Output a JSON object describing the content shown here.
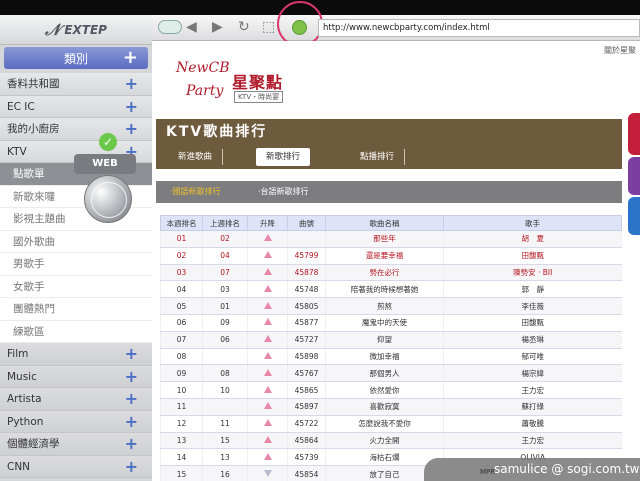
{
  "sidebar": {
    "logo": "EXTEP",
    "category": "類別",
    "items": [
      {
        "label": "香料共和國",
        "kind": "group"
      },
      {
        "label": "EC IC",
        "kind": "group"
      },
      {
        "label": "我的小廚房",
        "kind": "group"
      },
      {
        "label": "KTV",
        "kind": "group"
      },
      {
        "label": "點歌單",
        "kind": "sub-active"
      },
      {
        "label": "新歌來囉",
        "kind": "sub"
      },
      {
        "label": "影視主題曲",
        "kind": "sub"
      },
      {
        "label": "國外歌曲",
        "kind": "sub"
      },
      {
        "label": "男歌手",
        "kind": "sub"
      },
      {
        "label": "女歌手",
        "kind": "sub"
      },
      {
        "label": "團體熱門",
        "kind": "sub"
      },
      {
        "label": "練歌區",
        "kind": "sub"
      },
      {
        "label": "Film",
        "kind": "dark"
      },
      {
        "label": "Music",
        "kind": "dark"
      },
      {
        "label": "Artista",
        "kind": "dark"
      },
      {
        "label": "Python",
        "kind": "dark"
      },
      {
        "label": "個體經濟學",
        "kind": "dark"
      },
      {
        "label": "CNN",
        "kind": "dark"
      }
    ],
    "web_badge": "WEB"
  },
  "toolbar": {
    "url": "http://www.newcbparty.com/index.html"
  },
  "page": {
    "about": "關於星聚",
    "logo_newcb": "NewCB",
    "logo_party": "Party",
    "logo_cn": "星聚點",
    "logo_sub": "KTV・時尚宴",
    "title": "KTV歌曲排行",
    "tabs": [
      "新進歌曲",
      "新歌排行",
      "點播排行"
    ],
    "sub_tabs": [
      "‧國語新歌排行",
      "‧台語新歌排行"
    ],
    "table_headers": [
      "本週排名",
      "上週排名",
      "升降",
      "曲號",
      "歌曲名稱",
      "歌手"
    ],
    "rows": [
      {
        "rank": "01",
        "last": "02",
        "trend": "up",
        "code": "",
        "song": "那些年",
        "singer": "胡　夏",
        "red": true
      },
      {
        "rank": "02",
        "last": "04",
        "trend": "up",
        "code": "45799",
        "song": "還是要幸福",
        "singer": "田馥甄",
        "red": true
      },
      {
        "rank": "03",
        "last": "07",
        "trend": "up",
        "code": "45878",
        "song": "勢在必行",
        "singer": "陳勢安 · BII",
        "red": true
      },
      {
        "rank": "04",
        "last": "03",
        "trend": "up",
        "code": "45748",
        "song": "陪著我的時候想著她",
        "singer": "郭　靜",
        "red": false
      },
      {
        "rank": "05",
        "last": "01",
        "trend": "up",
        "code": "45805",
        "song": "煎熬",
        "singer": "李佳薇",
        "red": false
      },
      {
        "rank": "06",
        "last": "09",
        "trend": "up",
        "code": "45877",
        "song": "魔鬼中的天使",
        "singer": "田馥甄",
        "red": false
      },
      {
        "rank": "07",
        "last": "06",
        "trend": "up",
        "code": "45727",
        "song": "仰望",
        "singer": "楊丞琳",
        "red": false
      },
      {
        "rank": "08",
        "last": "",
        "trend": "up",
        "code": "45898",
        "song": "微加幸福",
        "singer": "郁可唯",
        "red": false
      },
      {
        "rank": "09",
        "last": "08",
        "trend": "up",
        "code": "45767",
        "song": "那個男人",
        "singer": "楊宗緯",
        "red": false
      },
      {
        "rank": "10",
        "last": "10",
        "trend": "up",
        "code": "45865",
        "song": "依然愛你",
        "singer": "王力宏",
        "red": false
      },
      {
        "rank": "11",
        "last": "",
        "trend": "up",
        "code": "45897",
        "song": "喜歡寂寞",
        "singer": "蘇打綠",
        "red": false
      },
      {
        "rank": "12",
        "last": "11",
        "trend": "up",
        "code": "45722",
        "song": "怎麼說我不愛你",
        "singer": "蕭敬騰",
        "red": false
      },
      {
        "rank": "13",
        "last": "15",
        "trend": "up",
        "code": "45864",
        "song": "火力全開",
        "singer": "王力宏",
        "red": false
      },
      {
        "rank": "14",
        "last": "13",
        "trend": "up",
        "code": "45739",
        "song": "海枯石爛",
        "singer": "OLIVIA",
        "red": false
      },
      {
        "rank": "15",
        "last": "16",
        "trend": "down",
        "code": "45854",
        "song": "放了自己",
        "singer": "",
        "red": false
      }
    ]
  },
  "watermark": {
    "text": "samulice @ sogi.com.tw",
    "small": "MPR"
  },
  "colors": {
    "header_brown": "#6e5b3d",
    "accent_red": "#b4141e",
    "sidebar_blue": "#5a6cc2",
    "highlight_yellow": "#f0c028"
  }
}
